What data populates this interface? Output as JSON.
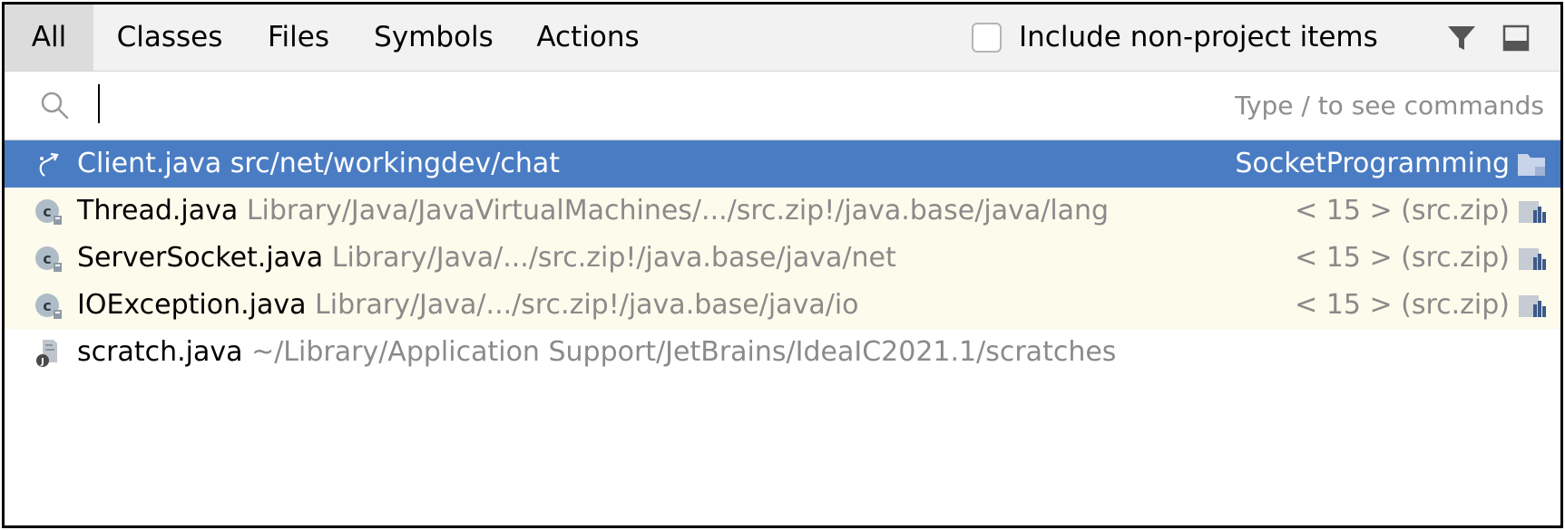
{
  "tabs": [
    {
      "label": "All",
      "active": true
    },
    {
      "label": "Classes",
      "active": false
    },
    {
      "label": "Files",
      "active": false
    },
    {
      "label": "Symbols",
      "active": false
    },
    {
      "label": "Actions",
      "active": false
    }
  ],
  "options": {
    "include_non_project_label": "Include non-project items",
    "include_non_project_checked": false,
    "filter_icon": "filter-icon",
    "open_in_window_icon": "open-in-tool-window-icon"
  },
  "search": {
    "value": "",
    "hint": "Type / to see commands",
    "icon": "search-icon"
  },
  "results": [
    {
      "name": "Client.java",
      "path": "src/net/workingdev/chat",
      "right": "SocketProgramming",
      "icon": "java-file-executable-icon",
      "right_icon": "project-folder-icon",
      "selected": true,
      "library": false
    },
    {
      "name": "Thread.java",
      "path": "Library/Java/JavaVirtualMachines/.../src.zip!/java.base/java/lang",
      "right": "< 15 > (src.zip)",
      "icon": "class-icon",
      "right_icon": "library-icon",
      "selected": false,
      "library": true
    },
    {
      "name": "ServerSocket.java",
      "path": "Library/Java/.../src.zip!/java.base/java/net",
      "right": "< 15 > (src.zip)",
      "icon": "class-icon",
      "right_icon": "library-icon",
      "selected": false,
      "library": true
    },
    {
      "name": "IOException.java",
      "path": "Library/Java/.../src.zip!/java.base/java/io",
      "right": "< 15 > (src.zip)",
      "icon": "class-icon",
      "right_icon": "library-icon",
      "selected": false,
      "library": true
    },
    {
      "name": "scratch.java",
      "path": "~/Library/Application Support/JetBrains/IdeaIC2021.1/scratches",
      "right": "",
      "icon": "scratch-file-icon",
      "right_icon": "",
      "selected": false,
      "library": false
    }
  ],
  "colors": {
    "selection": "#4a7cc3",
    "library_row": "#fcfbec",
    "tab_bar": "#f2f2f2",
    "active_tab": "#dcdcdc",
    "muted_text": "#8a8a8a"
  }
}
